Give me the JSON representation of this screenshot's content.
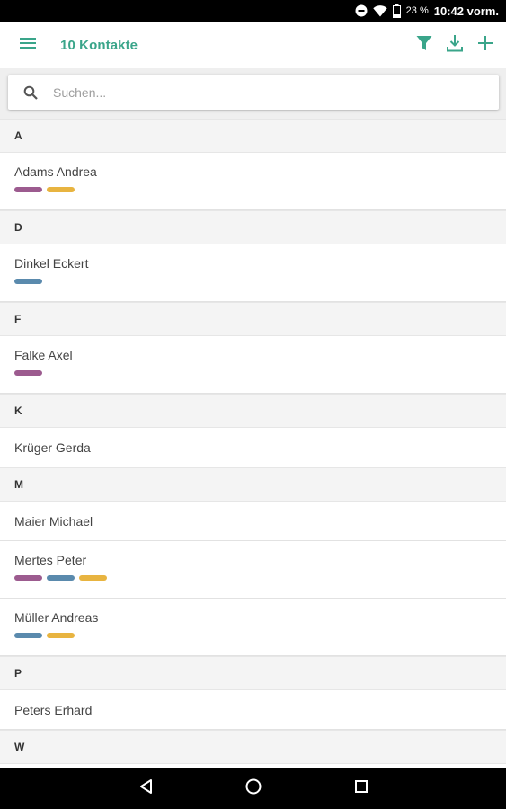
{
  "status_bar": {
    "battery_percent": "23 %",
    "time": "10:42 vorm.",
    "icons": [
      "do-not-disturb-icon",
      "wifi-icon",
      "battery-icon"
    ]
  },
  "app_bar": {
    "title": "10 Kontakte",
    "icons": [
      "menu-icon",
      "filter-icon",
      "download-icon",
      "add-icon"
    ],
    "accent_color": "#3aa58a"
  },
  "search": {
    "placeholder": "Suchen...",
    "value": ""
  },
  "tag_colors": {
    "purple": "#9c5b8f",
    "blue": "#5a8aad",
    "yellow": "#e8b440"
  },
  "contacts": {
    "sections": [
      {
        "letter": "A",
        "items": [
          {
            "name": "Adams Andrea",
            "tags": [
              "purple",
              "yellow"
            ]
          }
        ]
      },
      {
        "letter": "D",
        "items": [
          {
            "name": "Dinkel Eckert",
            "tags": [
              "blue"
            ]
          }
        ]
      },
      {
        "letter": "F",
        "items": [
          {
            "name": "Falke Axel",
            "tags": [
              "purple"
            ]
          }
        ]
      },
      {
        "letter": "K",
        "items": [
          {
            "name": "Krüger Gerda",
            "tags": []
          }
        ]
      },
      {
        "letter": "M",
        "items": [
          {
            "name": "Maier Michael",
            "tags": []
          },
          {
            "name": "Mertes Peter",
            "tags": [
              "purple",
              "blue",
              "yellow"
            ]
          },
          {
            "name": "Müller Andreas",
            "tags": [
              "blue",
              "yellow"
            ]
          }
        ]
      },
      {
        "letter": "P",
        "items": [
          {
            "name": "Peters Erhard",
            "tags": []
          }
        ]
      },
      {
        "letter": "W",
        "items": []
      }
    ]
  },
  "nav_bar": {
    "icons": [
      "back-icon",
      "home-icon",
      "recents-icon"
    ]
  }
}
